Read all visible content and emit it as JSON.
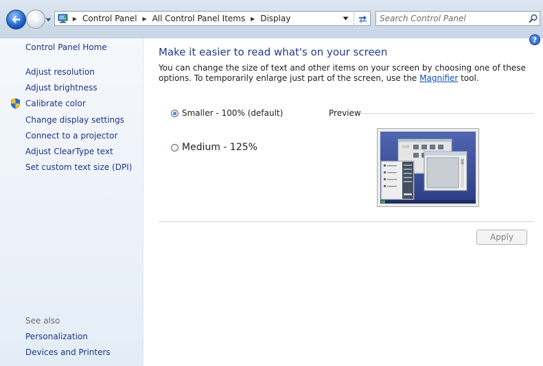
{
  "address": {
    "breadcrumbs": [
      "Control Panel",
      "All Control Panel Items",
      "Display"
    ]
  },
  "search": {
    "placeholder": "Search Control Panel"
  },
  "sidebar": {
    "home": "Control Panel Home",
    "tasks": [
      "Adjust resolution",
      "Adjust brightness",
      "Calibrate color",
      "Change display settings",
      "Connect to a projector",
      "Adjust ClearType text",
      "Set custom text size (DPI)"
    ],
    "see_also_label": "See also",
    "see_also": [
      "Personalization",
      "Devices and Printers"
    ]
  },
  "main": {
    "title": "Make it easier to read what's on your screen",
    "description_before": "You can change the size of text and other items on your screen by choosing one of these options. To temporarily enlarge just part of the screen, use the ",
    "magnifier_link": "Magnifier",
    "description_after": " tool.",
    "options": [
      {
        "label": "Smaller - 100% (default)",
        "selected": true
      },
      {
        "label": "Medium - 125%",
        "selected": false
      }
    ],
    "preview_label": "Preview",
    "apply_label": "Apply"
  },
  "icons": {
    "back": "back-arrow-icon",
    "forward": "forward-arrow-icon",
    "location": "control-panel-icon",
    "refresh": "refresh-icon",
    "search": "search-icon",
    "help": "help-icon",
    "shield": "uac-shield-icon"
  },
  "colors": {
    "link": "#1e3287",
    "title": "#1e3c87",
    "sidebar_top": "#f5f8fc",
    "sidebar_bottom": "#e4edf7",
    "preview_desktop": "#3b4f9a"
  }
}
